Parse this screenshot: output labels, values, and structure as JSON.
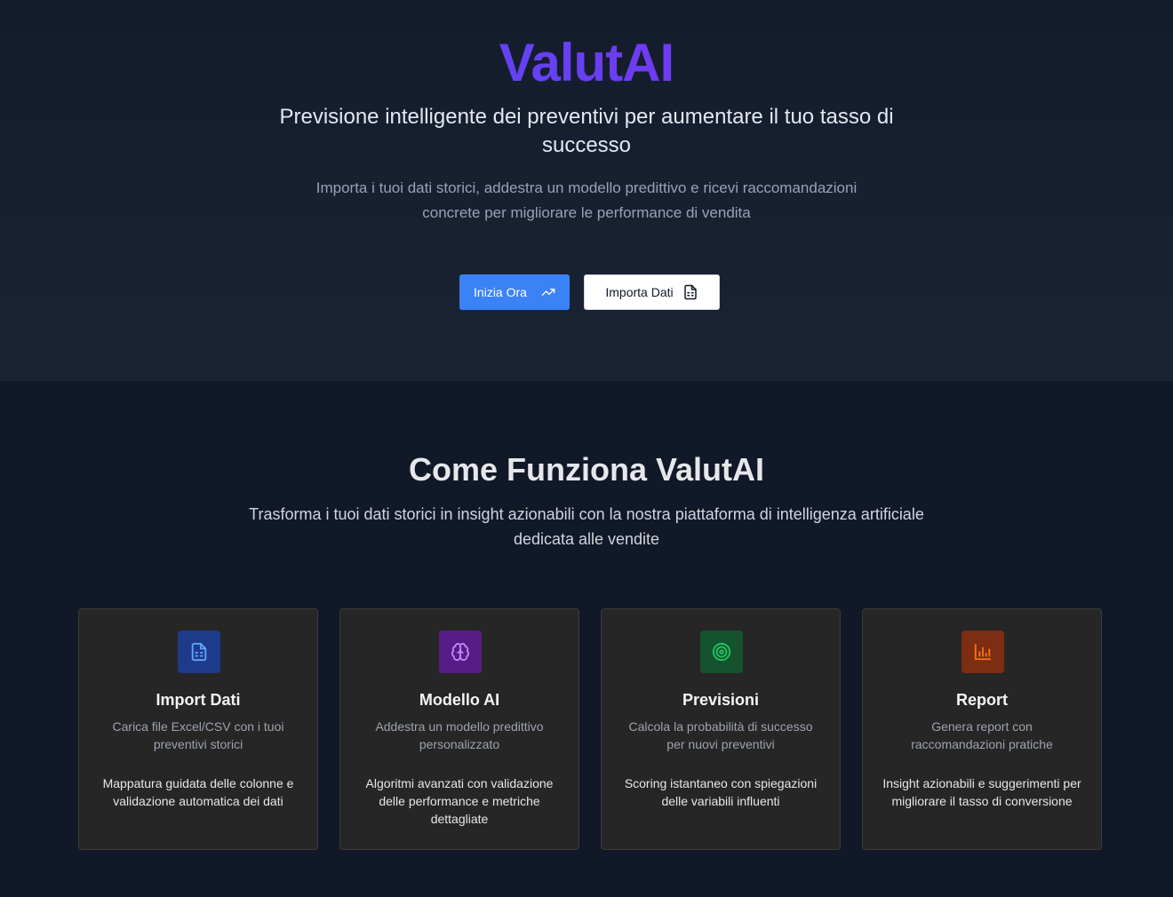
{
  "hero": {
    "brand": "ValutAI",
    "tagline": "Previsione intelligente dei preventivi per aumentare il tuo tasso di successo",
    "intro": "Importa i tuoi dati storici, addestra un modello predittivo e ricevi raccomandazioni concrete per migliorare le performance di vendita",
    "primary_button": "Inizia Ora",
    "primary_button_icon": "trending-up-icon",
    "secondary_button": "Importa Dati",
    "secondary_button_icon": "file-spreadsheet-icon",
    "brand_gradient": [
      "#3b5bf6",
      "#6d3cf0",
      "#9b27e6"
    ]
  },
  "how": {
    "title": "Come Funziona ValutAI",
    "subtitle": "Trasforma i tuoi dati storici in insight azionabili con la nostra piattaforma di intelligenza artificiale dedicata alle vendite",
    "cards": [
      {
        "title": "Import Dati",
        "description": "Carica file Excel/CSV con i tuoi preventivi storici",
        "detail": "Mappatura guidata delle colonne e validazione automatica dei dati",
        "icon": "file-spreadsheet-icon",
        "icon_bg": "#1e3a8a",
        "icon_color": "#60a5fa"
      },
      {
        "title": "Modello AI",
        "description": "Addestra un modello predittivo personalizzato",
        "detail": "Algoritmi avanzati con validazione delle performance e metriche dettagliate",
        "icon": "brain-icon",
        "icon_bg": "#581c87",
        "icon_color": "#c084fc"
      },
      {
        "title": "Previsioni",
        "description": "Calcola la probabilità di successo per nuovi preventivi",
        "detail": "Scoring istantaneo con spiegazioni delle variabili influenti",
        "icon": "target-icon",
        "icon_bg": "#14532d",
        "icon_color": "#22c55e"
      },
      {
        "title": "Report",
        "description": "Genera report con raccomandazioni pratiche",
        "detail": "Insight azionabili e suggerimenti per migliorare il tasso di conversione",
        "icon": "bar-chart-icon",
        "icon_bg": "#7c2d12",
        "icon_color": "#f97316"
      }
    ]
  }
}
